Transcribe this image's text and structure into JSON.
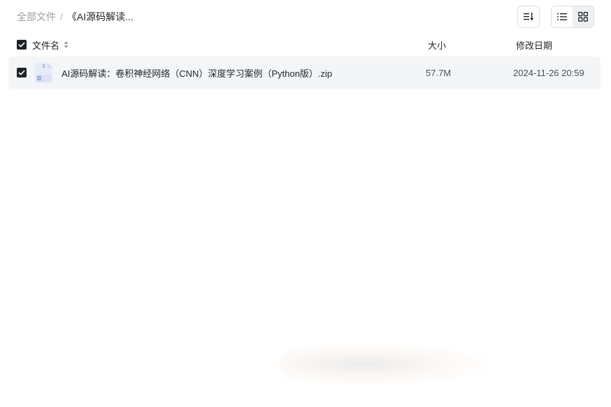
{
  "breadcrumb": {
    "root": "全部文件",
    "separator": "/",
    "current": "《AI源码解读..."
  },
  "toolbar": {
    "sort_icon": "sort-icon",
    "list_view_icon": "list-view-icon",
    "grid_view_icon": "grid-view-icon",
    "active_view": "list"
  },
  "columns": {
    "name": "文件名",
    "size": "大小",
    "date": "修改日期"
  },
  "files": [
    {
      "name": "AI源码解读：卷积神经网络（CNN）深度学习案例（Python版）.zip",
      "size": "57.7M",
      "modified": "2024-11-26 20:59",
      "checked": true,
      "icon": "zip-file-icon"
    }
  ],
  "colors": {
    "accent": "#1f2329",
    "row_highlight": "#f4f5f6",
    "muted_text": "#9aa0a6"
  }
}
